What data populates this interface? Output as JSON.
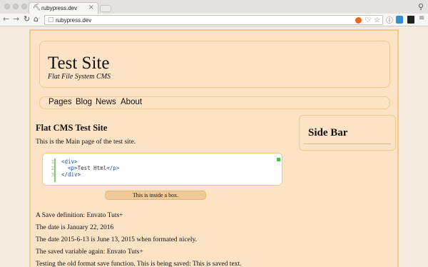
{
  "browser": {
    "tab": {
      "favicon": "ruby-favicon",
      "title": "rubypress.dev",
      "close": "×"
    },
    "address_bar": {
      "url": "rubypress.dev"
    },
    "icons": {
      "back": "←",
      "forward": "→",
      "reload": "↻",
      "home": "⌂",
      "bookmark": "♡",
      "star": "☆",
      "info": "ⓘ",
      "menu": "≡",
      "profile": "👤"
    }
  },
  "site": {
    "title": "Test Site",
    "subtitle": "Flat File System CMS",
    "nav": [
      "Pages",
      "Blog",
      "News",
      "About"
    ]
  },
  "main": {
    "title": "Flat CMS Test Site",
    "intro": "This is the Main page of the test site.",
    "code": {
      "line_numbers": [
        "1",
        "2",
        "3"
      ],
      "lines": [
        {
          "open": "<div>",
          "inner": "",
          "close": ""
        },
        {
          "open": "  <p>",
          "inner": "Test Html",
          "close": "</p>"
        },
        {
          "open": "</div>",
          "inner": "",
          "close": ""
        }
      ]
    },
    "box_text": "This is inside a box.",
    "paragraphs": [
      "A Save definition: Envato Tuts+",
      "The date is January 22, 2016",
      "The date 2015-6-13 is June 13, 2015 when formated nicely.",
      "The saved variable again: Envato Tuts+",
      "Testing the old format save function. This is being saved: This is saved text."
    ]
  },
  "sidebar": {
    "title": "Side Bar"
  },
  "colors": {
    "page_bg": "#fce3c5",
    "border_accent": "#f0c88a",
    "box_bg": "#f0c998",
    "code_gutter": "#7fcf6a"
  }
}
